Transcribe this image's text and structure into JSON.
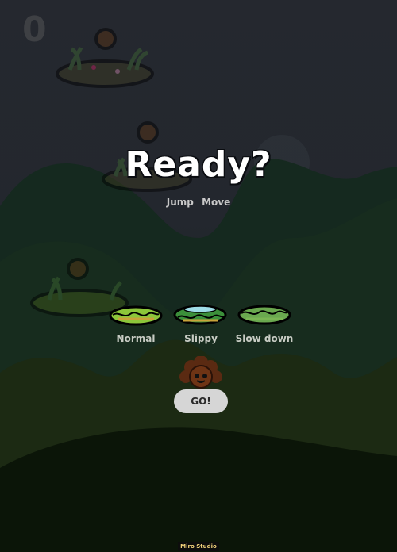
{
  "score": "0",
  "title": "Ready?",
  "controls": {
    "jump": "Jump",
    "move": "Move"
  },
  "platform_types": [
    {
      "label": "Normal",
      "icon": "normal-platform-icon"
    },
    {
      "label": "Slippy",
      "icon": "slippy-platform-icon"
    },
    {
      "label": "Slow down",
      "icon": "slowdown-platform-icon"
    }
  ],
  "player_icon": "flower-character-icon",
  "go_button": "GO!",
  "studio": "Miro Studio",
  "colors": {
    "overlay": "#23262c",
    "hill_dark": "#0b1407",
    "text": "#ffffff"
  }
}
